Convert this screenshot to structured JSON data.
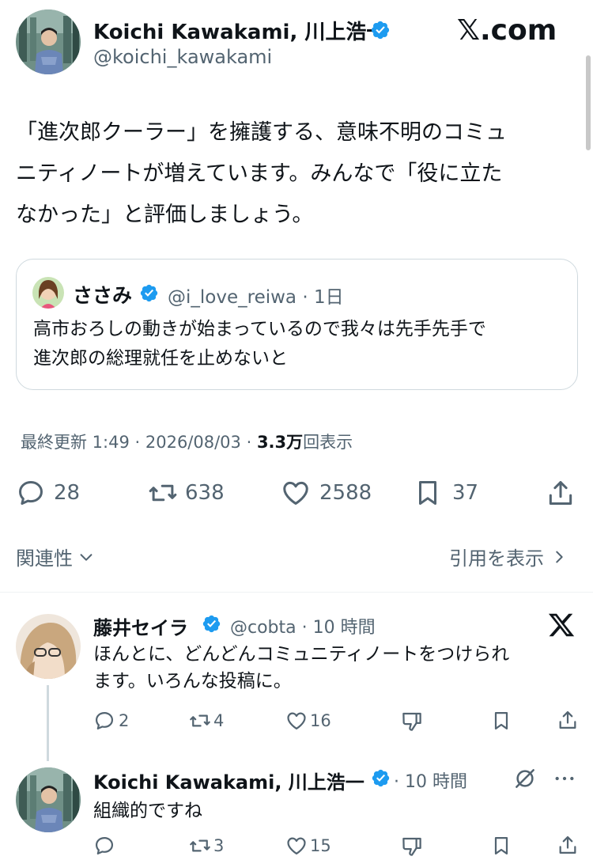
{
  "main_post": {
    "author_name": "Koichi Kawakami, 川上浩一",
    "author_handle": "@koichi_kawakami",
    "brand": "𝕏.com",
    "text_lines": [
      "「進次郎クーラー」を擁護する、意味不明のコミュ",
      "ニティノートが増えています。みんなで「役に立た",
      "なかった」と評価しましょう。"
    ],
    "timestamp": "最終更新 1:49 · 2026/08/03 ·",
    "views_count": "3.3万",
    "views_label": "回表示",
    "replies": "28",
    "reposts": "638",
    "likes": "2588",
    "bookmarks": "37"
  },
  "quote": {
    "author_name": "ささみ",
    "author_handle": "@i_love_reiwa · 1日",
    "text_lines": [
      "高市おろしの動きが始まっているので我々は先手先手で",
      "進次郎の総理就任を止めないと"
    ]
  },
  "sort_bar": {
    "relevance_label": "関連性",
    "view_quotes_label": "引用を表示"
  },
  "reply1": {
    "author_name": "藤井セイラ",
    "author_handle": "@cobta · 10 時間",
    "text_lines": [
      "ほんとに、どんどんコミュニティノートをつけられ",
      "ます。いろんな投稿に。"
    ],
    "replies": "2",
    "reposts": "4",
    "likes": "16"
  },
  "reply2": {
    "author_name": "Koichi Kawakami, 川上浩一",
    "author_handle": "· 10 時間",
    "text": "組織的ですね",
    "replies": "",
    "reposts": "3",
    "likes": "15"
  },
  "colors": {
    "verified": "#1d9bf0",
    "text": "#0f1419",
    "muted": "#536471",
    "border": "#cfd9de"
  }
}
